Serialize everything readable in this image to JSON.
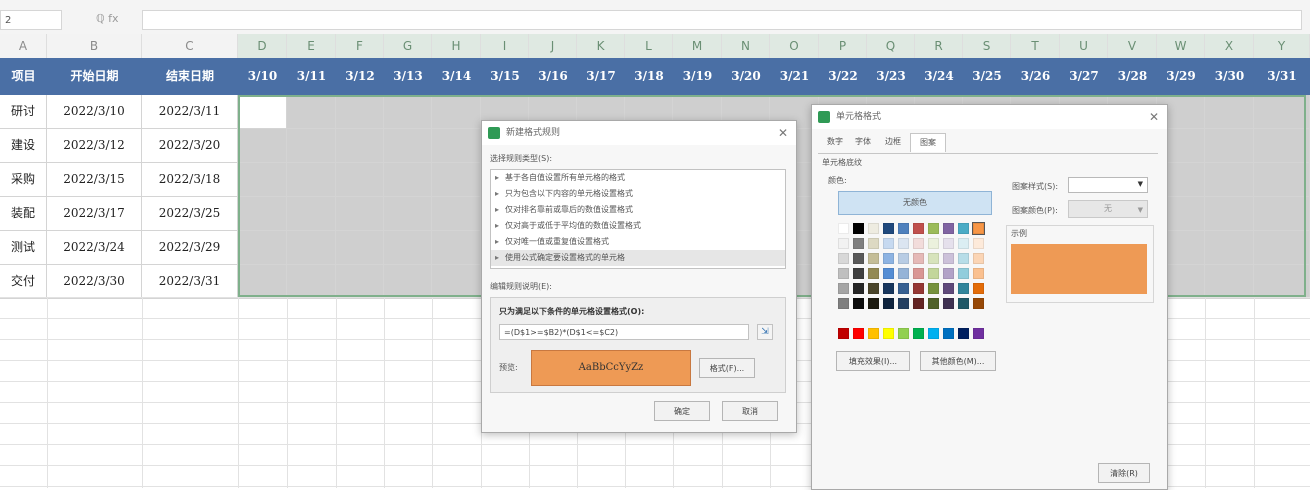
{
  "formula_bar": {
    "name_box": "2",
    "fx": "ℚ fx",
    "content": ""
  },
  "columns": [
    "A",
    "B",
    "C",
    "D",
    "E",
    "F",
    "G",
    "H",
    "I",
    "J",
    "K",
    "L",
    "M",
    "N",
    "O",
    "P",
    "Q",
    "R",
    "S",
    "T",
    "U",
    "V",
    "W",
    "X",
    "Y"
  ],
  "header": {
    "task": "项目",
    "start": "开始日期",
    "end": "结束日期",
    "dates": [
      "3/10",
      "3/11",
      "3/12",
      "3/13",
      "3/14",
      "3/15",
      "3/16",
      "3/17",
      "3/18",
      "3/19",
      "3/20",
      "3/21",
      "3/22",
      "3/23",
      "3/24",
      "3/25",
      "3/26",
      "3/27",
      "3/28",
      "3/29",
      "3/30",
      "3/31"
    ]
  },
  "rows": [
    {
      "task": "研讨",
      "start": "2022/3/10",
      "end": "2022/3/11"
    },
    {
      "task": "建设",
      "start": "2022/3/12",
      "end": "2022/3/20"
    },
    {
      "task": "采购",
      "start": "2022/3/15",
      "end": "2022/3/18"
    },
    {
      "task": "装配",
      "start": "2022/3/17",
      "end": "2022/3/25"
    },
    {
      "task": "测试",
      "start": "2022/3/24",
      "end": "2022/3/29"
    },
    {
      "task": "交付",
      "start": "2022/3/30",
      "end": "2022/3/31"
    }
  ],
  "rule_dialog": {
    "title": "新建格式规则",
    "select_type_label": "选择规则类型(S):",
    "rule_types": [
      "基于各自值设置所有单元格的格式",
      "只为包含以下内容的单元格设置格式",
      "仅对排名靠前或靠后的数值设置格式",
      "仅对高于或低于平均值的数值设置格式",
      "仅对唯一值或重复值设置格式",
      "使用公式确定要设置格式的单元格"
    ],
    "edit_label": "编辑规则说明(E):",
    "formula_label": "只为满足以下条件的单元格设置格式(O):",
    "formula": "=(D$1>=$B2)*(D$1<=$C2)",
    "preview_label": "预览:",
    "preview_text": "AaBbCcYyZz",
    "format_button": "格式(F)...",
    "ok": "确定",
    "cancel": "取消"
  },
  "cell_dialog": {
    "title": "单元格格式",
    "tabs": [
      "数字",
      "字体",
      "边框",
      "图案"
    ],
    "active_tab": "图案",
    "shading_label": "单元格底纹",
    "color_label": "颜色:",
    "no_color": "无颜色",
    "pattern_style_label": "图案样式(S):",
    "pattern_color_label": "图案颜色(P):",
    "pattern_color_value": "无",
    "sample_label": "示例",
    "sample_color": "#ee9a55",
    "fill_effects": "填充效果(I)...",
    "more_colors": "其他颜色(M)...",
    "clear": "清除(R)"
  },
  "colors": {
    "header_bg": "#4a6fa5",
    "gantt_fill": "#cfcfcf",
    "selection_border": "#7fb08b",
    "orange": "#ee9a55"
  }
}
